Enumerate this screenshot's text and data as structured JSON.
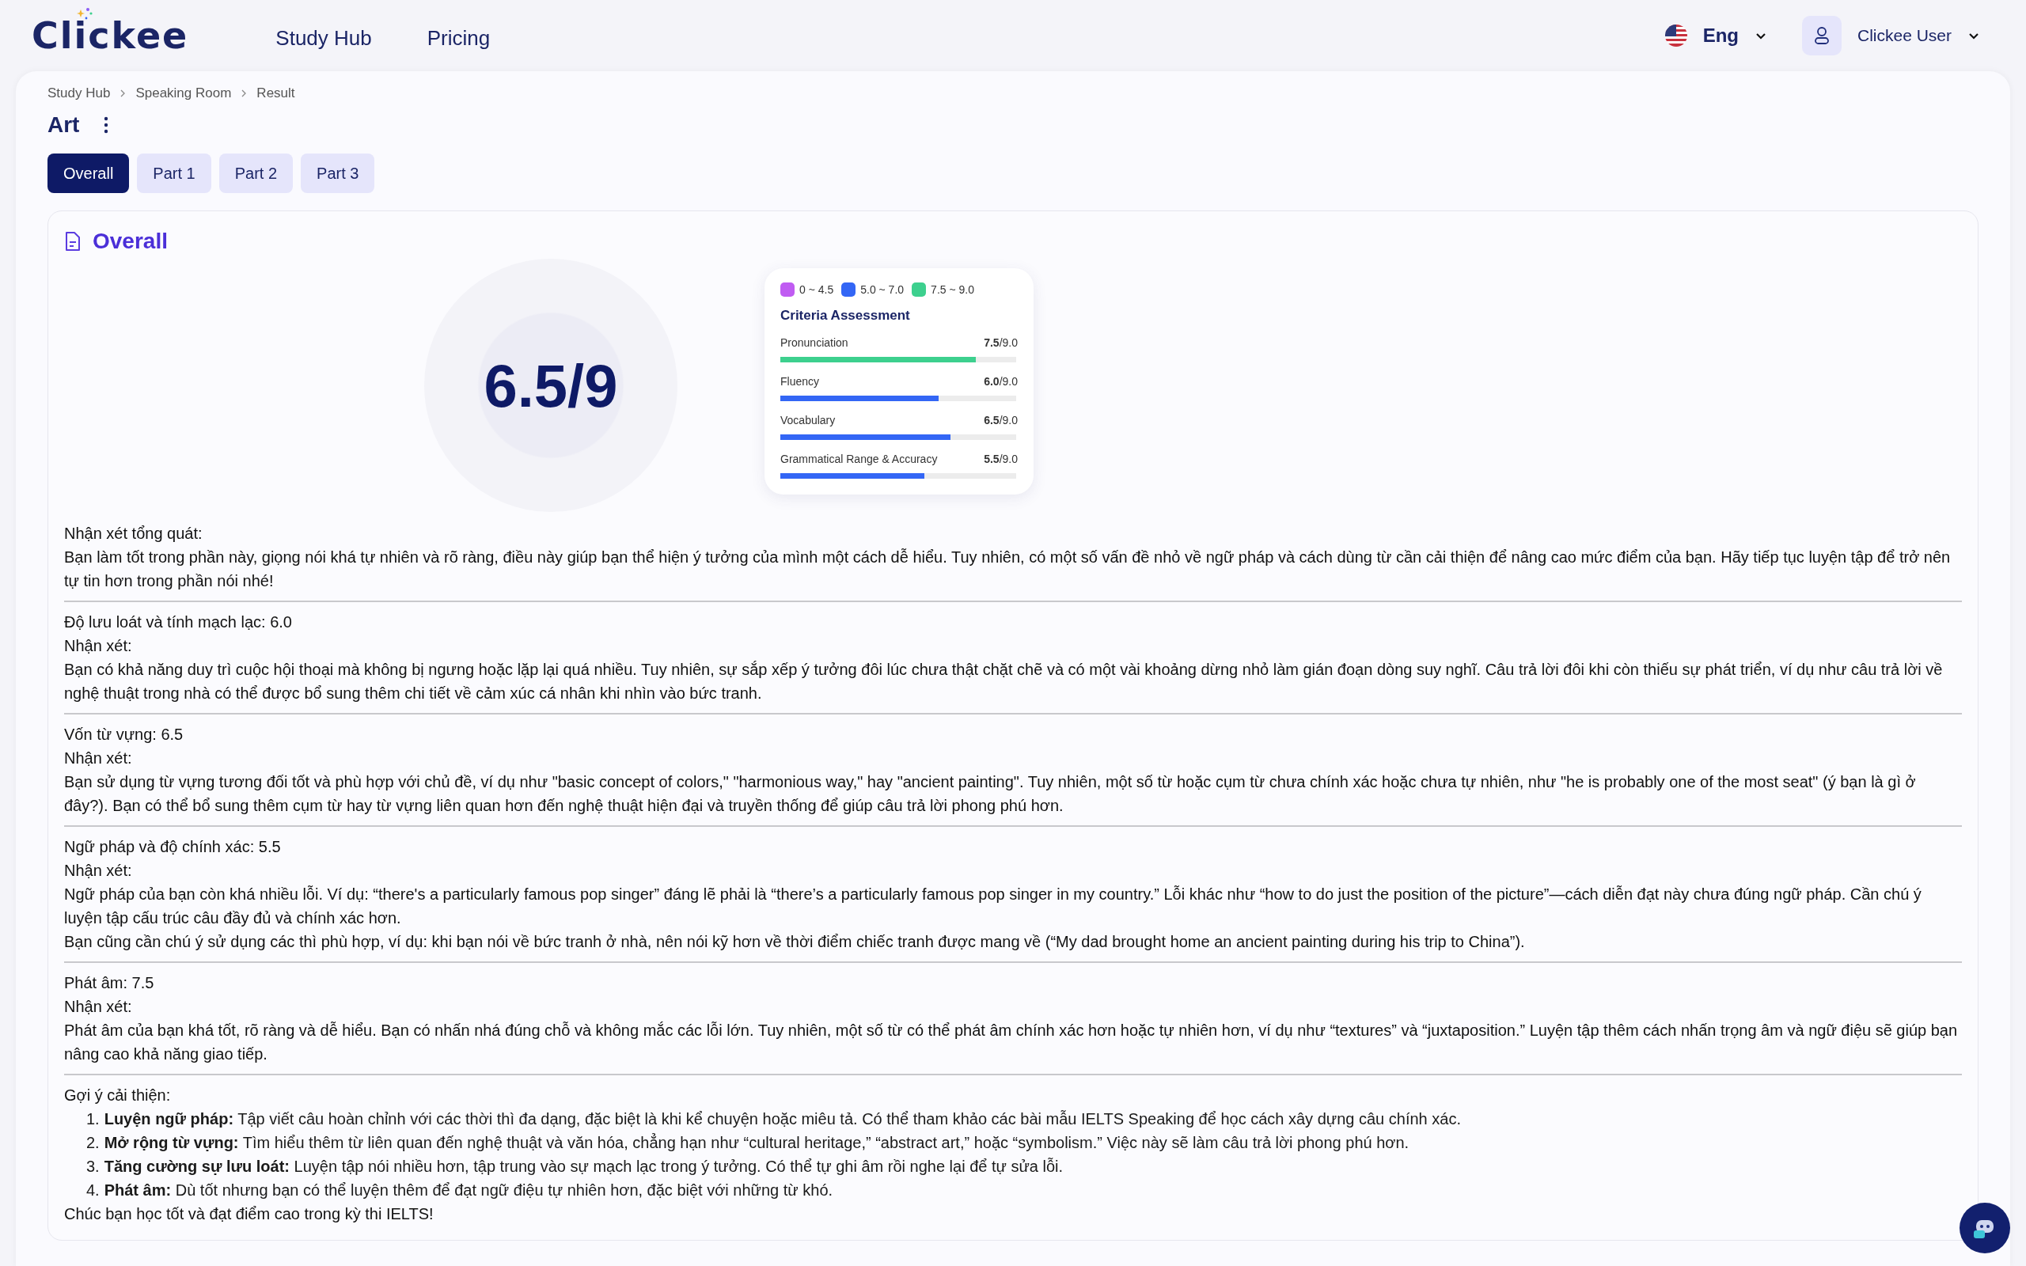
{
  "header": {
    "logo": "Clickee",
    "nav": [
      {
        "label": "Study Hub"
      },
      {
        "label": "Pricing"
      }
    ],
    "language": "Eng",
    "user": "Clickee User"
  },
  "breadcrumb": [
    "Study Hub",
    "Speaking Room",
    "Result"
  ],
  "title": "Art",
  "tabs": [
    {
      "label": "Overall",
      "selected": true
    },
    {
      "label": "Part 1",
      "selected": false
    },
    {
      "label": "Part 2",
      "selected": false
    },
    {
      "label": "Part 3",
      "selected": false
    }
  ],
  "section_title": "Overall",
  "score": "6.5/9",
  "legend": [
    {
      "label": "0 ~ 4.5",
      "color": "#c05cf2"
    },
    {
      "label": "5.0 ~ 7.0",
      "color": "#3366f5"
    },
    {
      "label": "7.5 ~ 9.0",
      "color": "#3dd08e"
    }
  ],
  "criteria_title": "Criteria Assessment",
  "criteria": [
    {
      "name": "Pronunciation",
      "score": "**7.5**/9.0",
      "level": 0.83,
      "color": "#3dd08e"
    },
    {
      "name": "Fluency",
      "score": "**6.0**/9.0",
      "level": 0.67,
      "color": "#3366f5"
    },
    {
      "name": "Vocabulary",
      "score": "**6.5**/9.0",
      "level": 0.72,
      "color": "#3366f5"
    },
    {
      "name": "Grammatical Range & Accuracy",
      "score": "**5.5**/9.0",
      "level": 0.61,
      "color": "#3366f5"
    }
  ],
  "feedback": [
    {
      "heading": "Nhận xét tổng quát:",
      "paragraphs": [
        "Bạn làm tốt trong phần này, giọng nói khá tự nhiên và rõ ràng, điều này giúp bạn thể hiện ý tưởng của mình một cách dễ hiểu. Tuy nhiên, có một số vấn đề nhỏ về ngữ pháp và cách dùng từ cần cải thiện để nâng cao mức điểm của bạn. Hãy tiếp tục luyện tập để trở nên tự tin hơn trong phần nói nhé!"
      ]
    },
    {
      "heading": "Độ lưu loát và tính mạch lạc: 6.0",
      "subheading": "Nhận xét:",
      "paragraphs": [
        "Bạn có khả năng duy trì cuộc hội thoại mà không bị ngưng hoặc lặp lại quá nhiều. Tuy nhiên, sự sắp xếp ý tưởng đôi lúc chưa thật chặt chẽ và có một vài khoảng dừng nhỏ làm gián đoạn dòng suy nghĩ. Câu trả lời đôi khi còn thiếu sự phát triển, ví dụ như câu trả lời về nghệ thuật trong nhà có thể được bổ sung thêm chi tiết về cảm xúc cá nhân khi nhìn vào bức tranh."
      ]
    },
    {
      "heading": "Vốn từ vựng: 6.5",
      "subheading": "Nhận xét:",
      "paragraphs": [
        "Bạn sử dụng từ vựng tương đối tốt và phù hợp với chủ đề, ví dụ như \"basic concept of colors,\" \"harmonious way,\" hay \"ancient painting\". Tuy nhiên, một số từ hoặc cụm từ chưa chính xác hoặc chưa tự nhiên, như \"he is probably one of the most seat\" (ý bạn là gì ở đây?). Bạn có thể bổ sung thêm cụm từ hay từ vựng liên quan hơn đến nghệ thuật hiện đại và truyền thống để giúp câu trả lời phong phú hơn."
      ]
    },
    {
      "heading": "Ngữ pháp và độ chính xác: 5.5",
      "subheading": "Nhận xét:",
      "paragraphs": [
        "Ngữ pháp của bạn còn khá nhiều lỗi. Ví dụ: “there's a particularly famous pop singer” đáng lẽ phải là “there’s a particularly famous pop singer in my country.” Lỗi khác như “how to do just the position of the picture”—cách diễn đạt này chưa đúng ngữ pháp. Cần chú ý luyện tập cấu trúc câu đầy đủ và chính xác hơn.",
        "Bạn cũng cần chú ý sử dụng các thì phù hợp, ví dụ: khi bạn nói về bức tranh ở nhà, nên nói kỹ hơn về thời điểm chiếc tranh được mang về (“My dad brought home an ancient painting during his trip to China”)."
      ]
    },
    {
      "heading": "Phát âm: 7.5",
      "subheading": "Nhận xét:",
      "paragraphs": [
        "Phát âm của bạn khá tốt, rõ ràng và dễ hiểu. Bạn có nhấn nhá đúng chỗ và không mắc các lỗi lớn. Tuy nhiên, một số từ có thể phát âm chính xác hơn hoặc tự nhiên hơn, ví dụ như “textures” và “juxtaposition.” Luyện tập thêm cách nhấn trọng âm và ngữ điệu sẽ giúp bạn nâng cao khả năng giao tiếp."
      ]
    },
    {
      "heading": "Gợi ý cải thiện:",
      "items": [
        {
          "number": "1.",
          "text": "**Luyện ngữ pháp:** Tập viết câu hoàn chỉnh với các thời thì đa dạng, đặc biệt là khi kể chuyện hoặc miêu tả. Có thể tham khảo các bài mẫu IELTS Speaking để học cách xây dựng câu chính xác."
        },
        {
          "number": "2.",
          "text": "**Mở rộng từ vựng:** Tìm hiểu thêm từ liên quan đến nghệ thuật và văn hóa, chẳng hạn như “cultural heritage,” “abstract art,” hoặc “symbolism.” Việc này sẽ làm câu trả lời phong phú hơn."
        },
        {
          "number": "3.",
          "text": "**Tăng cường sự lưu loát:** Luyện tập nói nhiều hơn, tập trung vào sự mạch lạc trong ý tưởng. Có thể tự ghi âm rồi nghe lại để tự sửa lỗi."
        },
        {
          "number": "4.",
          "text": "**Phát âm:** Dù tốt nhưng bạn có thể luyện thêm để đạt ngữ điệu tự nhiên hơn, đặc biệt với những từ khó."
        }
      ],
      "closing": "Chúc bạn học tốt và đạt điểm cao trong kỳ thi IELTS!"
    }
  ]
}
